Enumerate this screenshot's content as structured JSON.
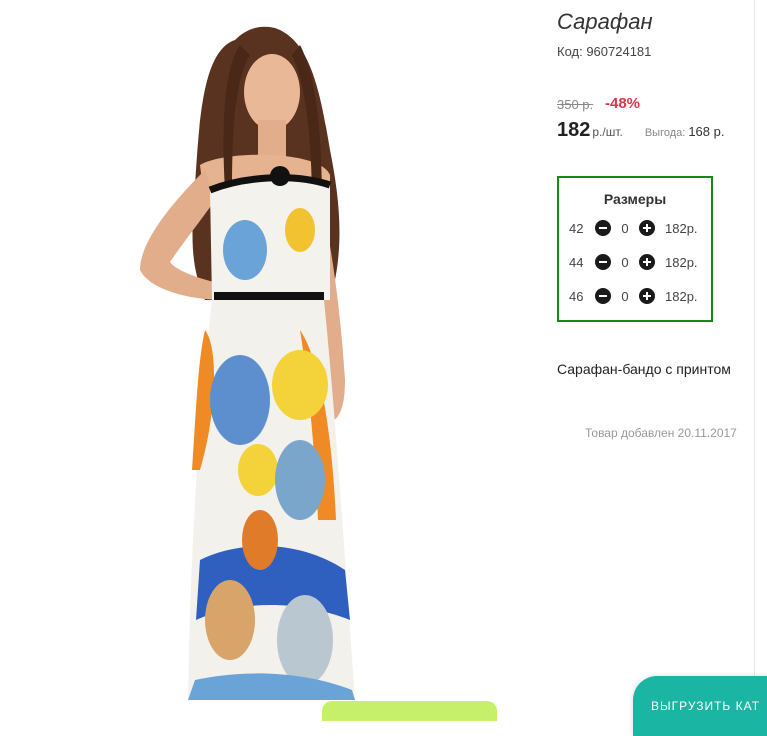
{
  "product": {
    "title": "Сарафан",
    "code_text": "Код: 960724181",
    "old_price": "350 р.",
    "discount": "-48%",
    "price": "182",
    "price_unit": "р./шт.",
    "benefit_label": "Выгода:",
    "benefit_value": "168 р.",
    "description": "Сарафан-бандо с принтом",
    "added": "Товар добавлен 20.11.2017"
  },
  "sizes": {
    "title": "Размеры",
    "rows": [
      {
        "size": "42",
        "qty": "0",
        "price": "182р."
      },
      {
        "size": "44",
        "qty": "0",
        "price": "182р."
      },
      {
        "size": "46",
        "qty": "0",
        "price": "182р."
      }
    ]
  },
  "bottom": {
    "export_label": "ВЫГРУЗИТЬ КАТ"
  },
  "colors": {
    "discount": "#e0334c",
    "sizes_border": "#138a13",
    "export_button": "#1bb5a3",
    "green_tab": "#c7f06a"
  }
}
